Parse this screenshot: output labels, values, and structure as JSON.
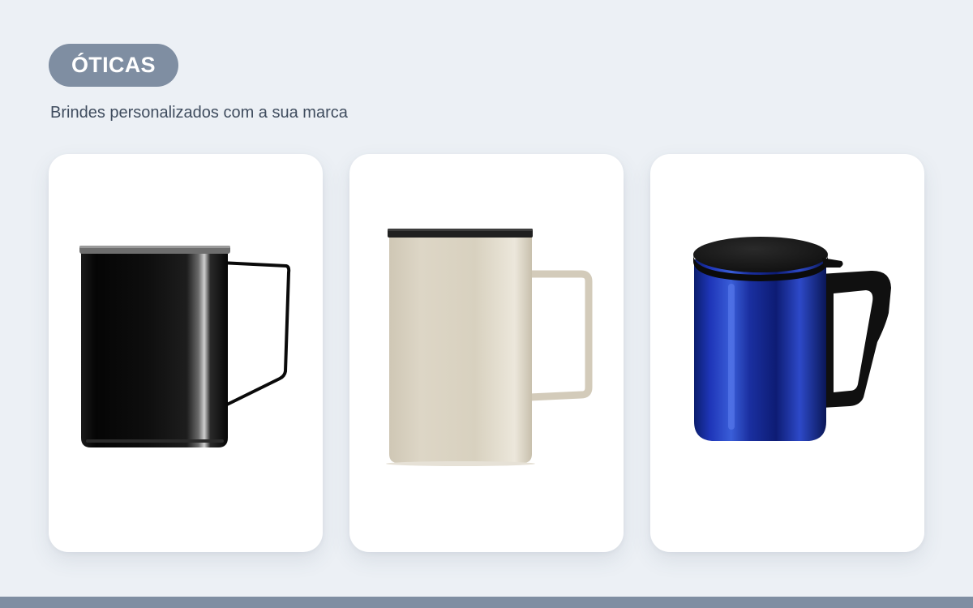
{
  "header": {
    "badge_label": "ÓTICAS",
    "subtitle": "Brindes personalizados com a sua marca"
  },
  "colors": {
    "background": "#ecf0f5",
    "accent": "#7f8ea2",
    "card": "#ffffff",
    "subtitle_text": "#3f4c5e"
  },
  "products": [
    {
      "image": "black-mug-with-wire-handle-and-lid",
      "color": "#0b0b0b"
    },
    {
      "image": "beige-mug-with-metal-handle-and-black-lid",
      "color": "#d9d2c1"
    },
    {
      "image": "blue-steel-mug-with-black-lid-and-handle",
      "color": "#1f35a8"
    }
  ]
}
